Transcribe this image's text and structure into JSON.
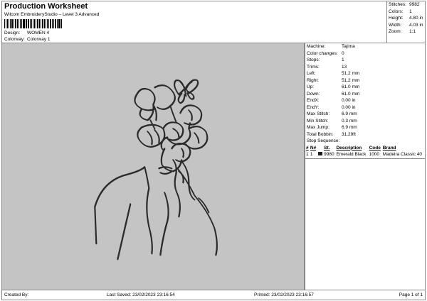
{
  "header": {
    "title": "Production Worksheet",
    "subtitle": "Wilcom EmbroideryStudio – Level 3 Advanced",
    "design_label": "Design:",
    "design_value": "WOMEN 4",
    "colorway_label": "Colorway:",
    "colorway_value": "Colorway 1"
  },
  "summary": [
    {
      "label": "Stitches:",
      "value": "9982"
    },
    {
      "label": "Colors:",
      "value": "1"
    },
    {
      "label": "Height:",
      "value": "4.80 in"
    },
    {
      "label": "Width:",
      "value": "4.03 in"
    },
    {
      "label": "Zoom:",
      "value": "1:1"
    }
  ],
  "details": [
    {
      "label": "Machine:",
      "value": "Tajima"
    },
    {
      "label": "Color changes:",
      "value": "0"
    },
    {
      "label": "Stops:",
      "value": "1"
    },
    {
      "label": "Trims:",
      "value": "13"
    },
    {
      "label": "Left:",
      "value": "51.2 mm"
    },
    {
      "label": "Right:",
      "value": "51.2 mm"
    },
    {
      "label": "Up:",
      "value": "61.0 mm"
    },
    {
      "label": "Down:",
      "value": "61.0 mm"
    },
    {
      "label": "EndX:",
      "value": "0.00 in"
    },
    {
      "label": "EndY:",
      "value": "0.00 in"
    },
    {
      "label": "Max Stitch:",
      "value": "6.9 mm"
    },
    {
      "label": "Min Stitch:",
      "value": "0.3 mm"
    },
    {
      "label": "Max Jump:",
      "value": "6.9 mm"
    },
    {
      "label": "Total Bobbin:",
      "value": "31.29ft"
    }
  ],
  "stop_sequence": {
    "title": "Stop Sequence:",
    "headers": [
      "#",
      "N#",
      "",
      "St.",
      "Description",
      "Code",
      "Brand"
    ],
    "rows": [
      {
        "index": "1",
        "needle": "1",
        "stitches": "9980",
        "description": "Emerald Black",
        "code": "1000",
        "brand": "Madeira Classic 40",
        "color": "#1e1e1e"
      }
    ]
  },
  "footer": {
    "created_by": "Created By:",
    "last_saved": "Last Saved: 23/02/2023 23:16:54",
    "printed": "Printed: 23/02/2023 23:16:57",
    "page": "Page 1 of 1"
  },
  "colors": {
    "canvas_bg": "#c4c4c4",
    "stitch_dark": "#2b2b2b",
    "stitch_light": "#9a9a9a"
  }
}
